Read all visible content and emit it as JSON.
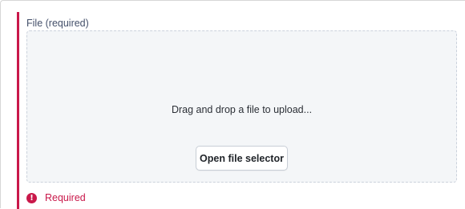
{
  "field": {
    "label": "File (required)",
    "dropzone_text": "Drag and drop a file to upload...",
    "open_button_label": "Open file selector",
    "error_icon_glyph": "!",
    "error_message": "Required"
  },
  "icons": {
    "error": "error-circle-icon"
  },
  "colors": {
    "error": "#c9184a",
    "dropzone_background": "#f4f6f8",
    "dropzone_border": "#cbd2dc",
    "label": "#44506a"
  }
}
